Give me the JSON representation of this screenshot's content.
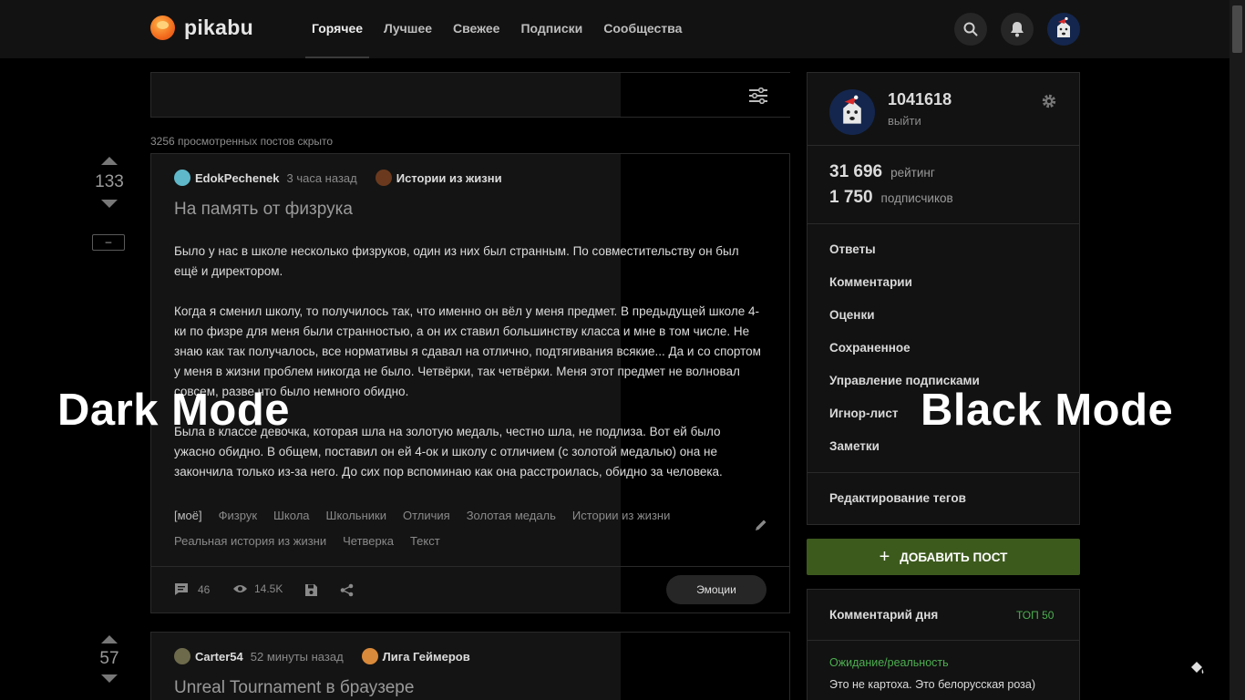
{
  "header": {
    "logo_text": "pikabu",
    "tabs": [
      {
        "label": "Горячее",
        "active": true
      },
      {
        "label": "Лучшее"
      },
      {
        "label": "Свежее"
      },
      {
        "label": "Подписки"
      },
      {
        "label": "Сообщества"
      }
    ],
    "icons": [
      "search-icon",
      "bell-icon",
      "user-avatar"
    ]
  },
  "feed": {
    "hidden_note": "3256 просмотренных постов скрыто"
  },
  "posts": [
    {
      "rating": "133",
      "minus_label": "–",
      "author": "EdokPechenek",
      "time": "3 часа назад",
      "community": "Истории из жизни",
      "title": "На память от физрука",
      "paragraphs": [
        "Было у нас в школе несколько физруков, один из них был странным. По совместительству он был ещё и директором.",
        "Когда я сменил школу, то получилось так, что именно он вёл у меня предмет. В предыдущей школе 4-ки по физре для меня были странностью, а он их ставил большинству класса и мне в том числе. Не знаю как так получалось, все нормативы я сдавал на отлично, подтягивания всякие... Да и со спортом у меня в жизни проблем никогда не было. Четвёрки, так четвёрки. Меня этот предмет не волновал совсем, разве что было немного обидно.",
        "Была в классе девочка, которая шла на золотую медаль, честно шла, не подлиза. Вот ей было ужасно обидно. В общем, поставил он ей 4-ок и школу с отличием (с золотой медалью) она не закончила только из-за него. До сих пор вспоминаю как она расстроилась, обидно за человека."
      ],
      "tags": [
        "[моё]",
        "Физрук",
        "Школа",
        "Школьники",
        "Отличия",
        "Золотая медаль",
        "Истории из жизни",
        "Реальная история из жизни",
        "Четверка",
        "Текст"
      ],
      "comments": "46",
      "views": "14.5K",
      "emotions_label": "Эмоции"
    },
    {
      "rating": "57",
      "author": "Carter54",
      "time": "52 минуты назад",
      "community": "Лига Геймеров",
      "title": "Unreal Tournament в браузере"
    }
  ],
  "sidebar": {
    "username": "1041618",
    "logout": "выйти",
    "rating_value": "31 696",
    "rating_label": "рейтинг",
    "subscribers_value": "1 750",
    "subscribers_label": "подписчиков",
    "menu": [
      "Ответы",
      "Комментарии",
      "Оценки",
      "Сохраненное",
      "Управление подписками",
      "Игнор-лист",
      "Заметки"
    ],
    "edit_tags": "Редактирование тегов",
    "add_post": "ДОБАВИТЬ ПОСТ",
    "comment_of_day": {
      "title": "Комментарий дня",
      "top_link": "ТОП 50",
      "post_link": "Ожидание/реальность",
      "text": "Это не картоха. Это белорусская роза)"
    }
  },
  "overlay": {
    "left": "Dark Mode",
    "right": "Black Mode"
  },
  "colors": {
    "accent_green": "#3d5a1d",
    "link_green": "#4caf50"
  }
}
